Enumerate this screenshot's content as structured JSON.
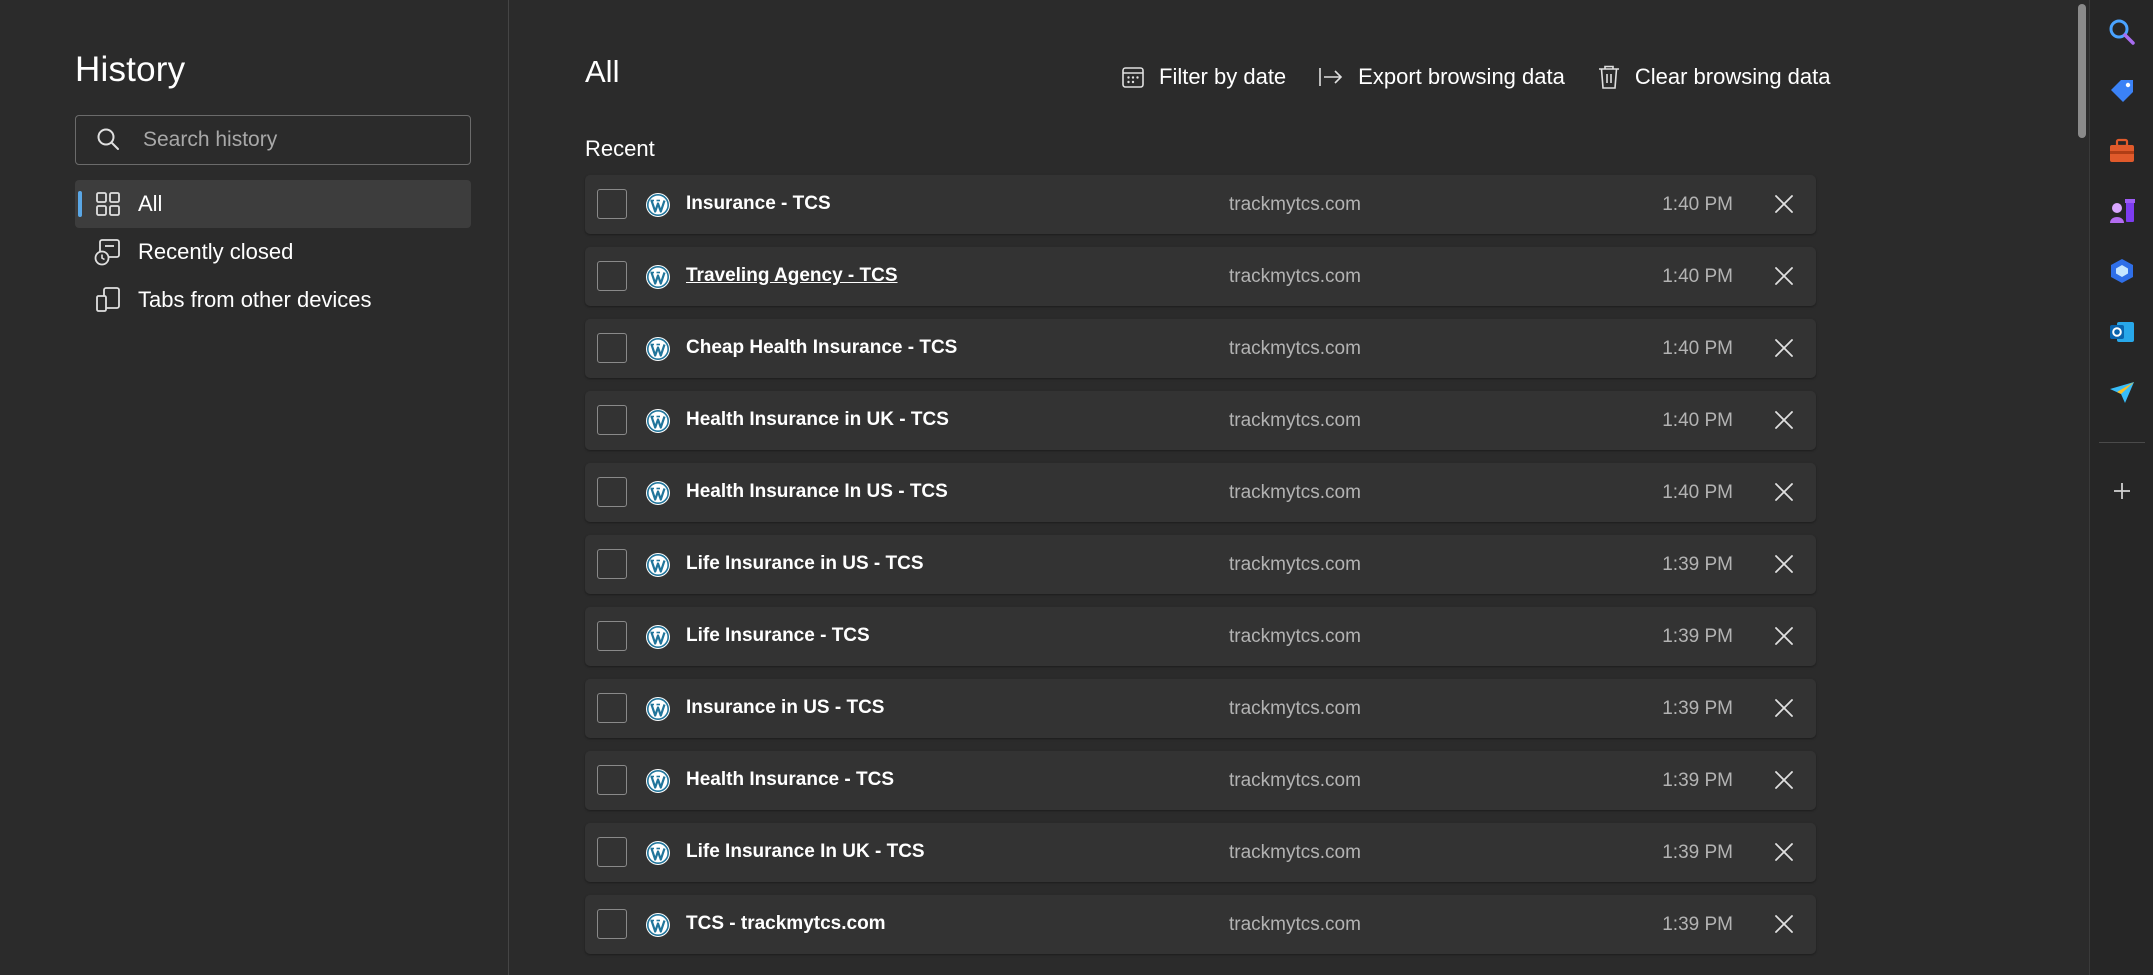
{
  "sidebar": {
    "title": "History",
    "search": {
      "placeholder": "Search history",
      "value": ""
    },
    "nav": [
      {
        "label": "All",
        "icon": "grid-icon",
        "active": true
      },
      {
        "label": "Recently closed",
        "icon": "recently-closed-icon",
        "active": false
      },
      {
        "label": "Tabs from other devices",
        "icon": "devices-icon",
        "active": false
      }
    ]
  },
  "main": {
    "title": "All",
    "toolbar": {
      "filter_label": "Filter by date",
      "export_label": "Export browsing data",
      "clear_label": "Clear browsing data"
    },
    "section_label": "Recent",
    "rows": [
      {
        "title": "Insurance - TCS",
        "domain": "trackmytcs.com",
        "time": "1:40 PM"
      },
      {
        "title": "Traveling Agency - TCS",
        "domain": "trackmytcs.com",
        "time": "1:40 PM"
      },
      {
        "title": "Cheap Health Insurance - TCS",
        "domain": "trackmytcs.com",
        "time": "1:40 PM"
      },
      {
        "title": "Health Insurance in UK - TCS",
        "domain": "trackmytcs.com",
        "time": "1:40 PM"
      },
      {
        "title": "Health Insurance In US - TCS",
        "domain": "trackmytcs.com",
        "time": "1:40 PM"
      },
      {
        "title": "Life Insurance in US - TCS",
        "domain": "trackmytcs.com",
        "time": "1:39 PM"
      },
      {
        "title": "Life Insurance - TCS",
        "domain": "trackmytcs.com",
        "time": "1:39 PM"
      },
      {
        "title": "Insurance in US - TCS",
        "domain": "trackmytcs.com",
        "time": "1:39 PM"
      },
      {
        "title": "Health Insurance - TCS",
        "domain": "trackmytcs.com",
        "time": "1:39 PM"
      },
      {
        "title": "Life Insurance In UK - TCS",
        "domain": "trackmytcs.com",
        "time": "1:39 PM"
      },
      {
        "title": "TCS - trackmytcs.com",
        "domain": "trackmytcs.com",
        "time": "1:39 PM"
      }
    ]
  },
  "right_sidebar": {
    "icons": [
      "search-icon",
      "shopping-tag-icon",
      "tools-icon",
      "games-icon",
      "copilot-icon",
      "outlook-icon",
      "send-icon",
      "add-icon"
    ]
  },
  "colors": {
    "background": "#2b2b2b",
    "row_background": "#333333",
    "accent": "#5aa7e6",
    "wordpress": "#21759b"
  }
}
